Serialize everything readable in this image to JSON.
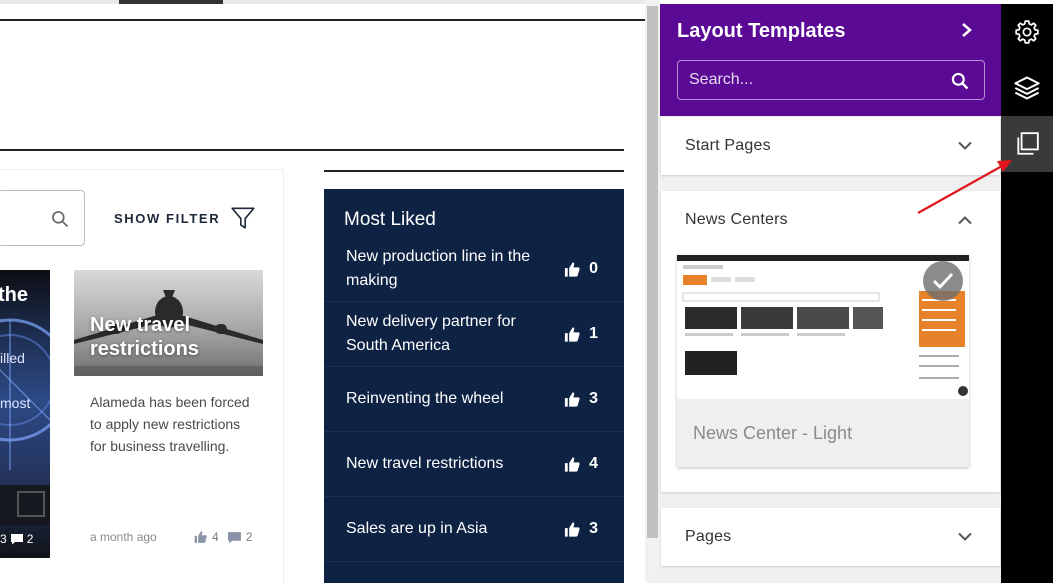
{
  "page": {
    "filter_label": "SHOW FILTER",
    "card_left": {
      "title_fragment": "the",
      "text_fragment_1": "illed",
      "text_fragment_2": "most",
      "likes": "3",
      "comments": "2"
    },
    "card_main": {
      "title": "New travel restrictions",
      "text": "Alameda has been forced to apply new restrictions for business travelling.",
      "time": "a month ago",
      "likes": "4",
      "comments": "2"
    },
    "most_liked": {
      "title": "Most Liked",
      "items": [
        {
          "text": "New production line in the making",
          "count": "0"
        },
        {
          "text": "New delivery partner for South America",
          "count": "1"
        },
        {
          "text": "Reinventing the wheel",
          "count": "3"
        },
        {
          "text": "New travel restrictions",
          "count": "4"
        },
        {
          "text": "Sales are up in Asia",
          "count": "3"
        }
      ]
    }
  },
  "panel": {
    "title": "Layout Templates",
    "search_placeholder": "Search...",
    "sections": {
      "start_pages": "Start Pages",
      "news_centers": "News Centers",
      "pages": "Pages"
    },
    "template": {
      "name": "News Center - Light"
    }
  },
  "rail": {
    "icons": [
      "gear-icon",
      "layers-icon",
      "copy-icon"
    ]
  },
  "colors": {
    "panel_header": "#5a0a94",
    "most_liked_bg": "#0e2244",
    "annotation_arrow": "#e0161b"
  }
}
